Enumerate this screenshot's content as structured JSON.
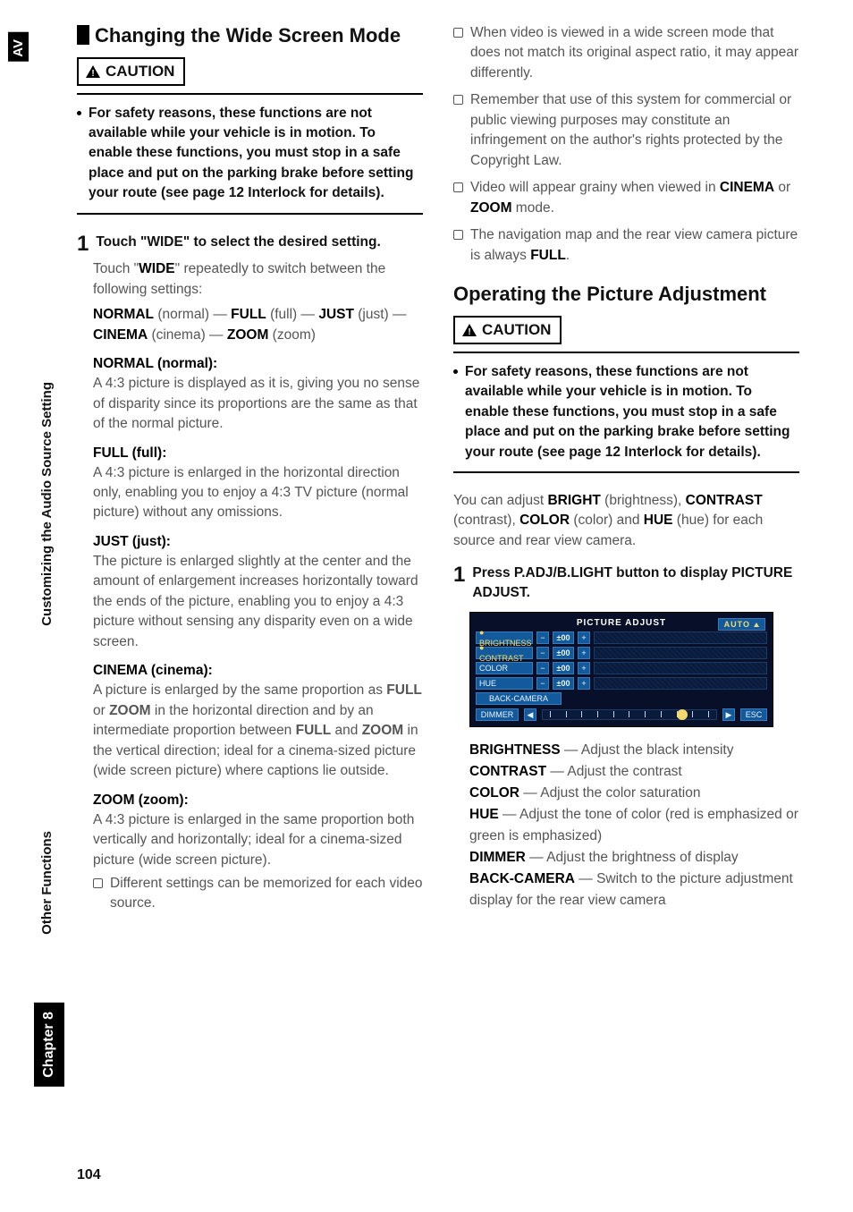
{
  "side": {
    "av": "AV",
    "chapter_label": "Chapter 8",
    "other": "Other Functions",
    "customizing": "Customizing the Audio Source Setting"
  },
  "page_number": "104",
  "left": {
    "heading": "Changing the Wide Screen Mode",
    "caution": "CAUTION",
    "caution_text": "For safety reasons, these functions are not available while your vehicle is in motion. To enable these functions, you must stop in a safe place and put on the parking brake before setting your route (see page 12 Interlock for details).",
    "step_num": "1",
    "step_title": "Touch \"WIDE\" to select the desired setting.",
    "step_desc_pre": "Touch \"",
    "step_desc_bold": "WIDE",
    "step_desc_post": "\" repeatedly to switch between the following settings:",
    "modes_line_html": "<b>NORMAL</b> (normal) — <b>FULL</b> (full) — <b>JUST</b> (just) — <b>CINEMA</b> (cinema) — <b>ZOOM</b> (zoom)",
    "normal_h": "NORMAL (normal):",
    "normal_d": "A 4:3 picture is displayed as it is, giving you no sense of disparity since its proportions are the same as that of the normal picture.",
    "full_h": "FULL (full):",
    "full_d": "A 4:3 picture is enlarged in the horizontal direction only, enabling you to enjoy a 4:3 TV picture (normal picture) without any omissions.",
    "just_h": "JUST (just):",
    "just_d": "The picture is enlarged slightly at the center and the amount of enlargement increases horizontally toward the ends of the picture, enabling you to enjoy a 4:3 picture without sensing any disparity even on a wide screen.",
    "cinema_h": "CINEMA (cinema):",
    "cinema_d_html": "A picture is enlarged by the same proportion as <b>FULL</b> or <b>ZOOM</b> in the horizontal direction and by an intermediate proportion between <b>FULL</b> and <b>ZOOM</b> in the vertical direction; ideal for a cinema-sized picture (wide screen picture) where captions lie outside.",
    "zoom_h": "ZOOM (zoom):",
    "zoom_d": "A 4:3 picture is enlarged in the same proportion both vertically and horizontally; ideal for a cinema-sized picture (wide screen picture).",
    "note1": "Different settings can be memorized for each video source."
  },
  "right": {
    "note_a": "When video is viewed in a wide screen mode that does not match its original aspect ratio, it may appear differently.",
    "note_b": "Remember that use of this system for commercial or public viewing purposes may constitute an infringement on the author's rights protected by the Copyright Law.",
    "note_c_html": "Video will appear grainy when viewed in <b>CINEMA</b> or <b>ZOOM</b> mode.",
    "note_d_html": "The navigation map and the rear view camera picture is always <b>FULL</b>.",
    "heading": "Operating the Picture Adjustment",
    "caution": "CAUTION",
    "caution_text": "For safety reasons, these functions are not available while your vehicle is in motion. To enable these functions, you must stop in a safe place and put on the parking brake before setting your route (see page 12 Interlock for details).",
    "intro_html": "You can adjust <b>BRIGHT</b> (brightness), <b>CONTRAST</b> (contrast), <b>COLOR</b> (color) and <b>HUE</b> (hue) for each source and rear view camera.",
    "step_num": "1",
    "step_title": "Press P.ADJ/B.LIGHT button to display PICTURE ADJUST.",
    "pic_adjust": {
      "title": "PICTURE ADJUST",
      "auto": "AUTO",
      "rows": [
        {
          "label": "BRIGHTNESS",
          "val": "±00",
          "active": true
        },
        {
          "label": "CONTRAST",
          "val": "±00",
          "active": true
        },
        {
          "label": "COLOR",
          "val": "±00",
          "active": false
        },
        {
          "label": "HUE",
          "val": "±00",
          "active": false
        }
      ],
      "back": "BACK-CAMERA",
      "dimmer": "DIMMER",
      "esc": "ESC"
    },
    "defs_html": "<b>BRIGHTNESS</b> — Adjust the black intensity<br><b>CONTRAST</b> — Adjust the contrast<br><b>COLOR</b> — Adjust the color saturation<br><b>HUE</b> — Adjust the tone of color (red is emphasized or green is emphasized)<br><b>DIMMER</b> — Adjust the brightness of display<br><b>BACK-CAMERA</b> — Switch to the picture adjustment display for the rear view camera"
  }
}
